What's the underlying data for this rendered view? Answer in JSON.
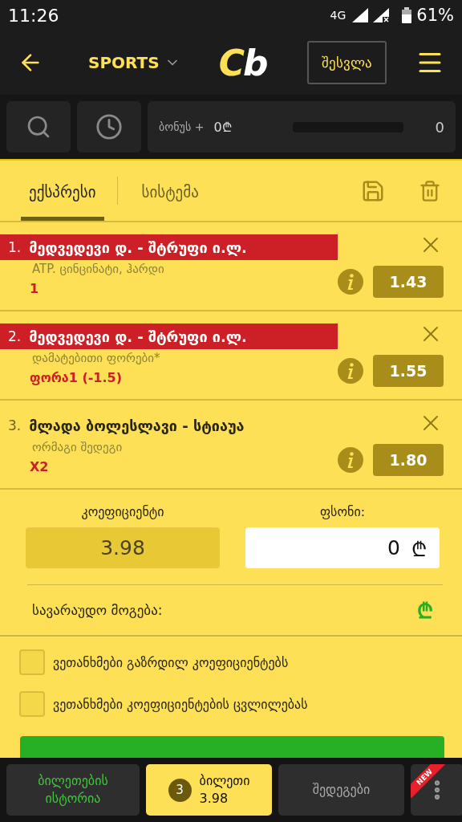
{
  "status_bar": {
    "time": "11:26",
    "network": "4G",
    "battery": "61%"
  },
  "header": {
    "section": "SPORTS",
    "logo": [
      {
        "text": "C",
        "kind": "accent"
      },
      {
        "text": "b",
        "kind": "plain"
      }
    ],
    "login_button": "შესვლა"
  },
  "toolbar": {
    "bonus_label": "ბონუს +",
    "bonus_amount": "0₾",
    "bonus_progress": {
      "level": 0
    },
    "bonus_count": "0"
  },
  "tabs": [
    {
      "label": "ექსპრესი",
      "selected": true
    },
    {
      "label": "სისტემა",
      "selected": false
    }
  ],
  "bets": [
    {
      "number": "1.",
      "match": "მედვედევი დ. - შტრუფი ი.ლ.",
      "highlighted": true,
      "market": "ATP. ცინცინატი, ჰარდი",
      "pick": "1",
      "odds": "1.43"
    },
    {
      "number": "2.",
      "match": "მედვედევი დ. - შტრუფი ი.ლ.",
      "highlighted": true,
      "market": "დამატებითი ფორები*",
      "pick": "ფორა1 (-1.5)",
      "odds": "1.55"
    },
    {
      "number": "3.",
      "match": "მლადა ბოლესლავი - სტიაუა",
      "highlighted": false,
      "market": "ორმაგი შედეგი",
      "pick": "X2",
      "odds": "1.80"
    }
  ],
  "summary": {
    "odds_label": "კოეფიციენტი",
    "odds_value": "3.98",
    "stake_label": "ფსონი:",
    "stake_value": "0",
    "stake_currency": "₾",
    "winnings_label": "სავარაუდო მოგება:",
    "winnings_currency": "₾"
  },
  "options": [
    {
      "label": "ვეთანხმები გაზრდილ კოეფიციენტებს",
      "checked": false
    },
    {
      "label": "ვეთანხმები კოეფიციენტების ცვლილებას",
      "checked": false
    }
  ],
  "bottom_nav": [
    {
      "kind": "text",
      "label": "ბილეთების ისტორია",
      "selected": false
    },
    {
      "kind": "ticket",
      "count": "3",
      "label": "ბილეთი",
      "value": "3.98",
      "selected": true
    },
    {
      "kind": "text",
      "label": "შედეგები",
      "selected": false
    },
    {
      "kind": "more",
      "badge": "NEW",
      "selected": false
    }
  ]
}
